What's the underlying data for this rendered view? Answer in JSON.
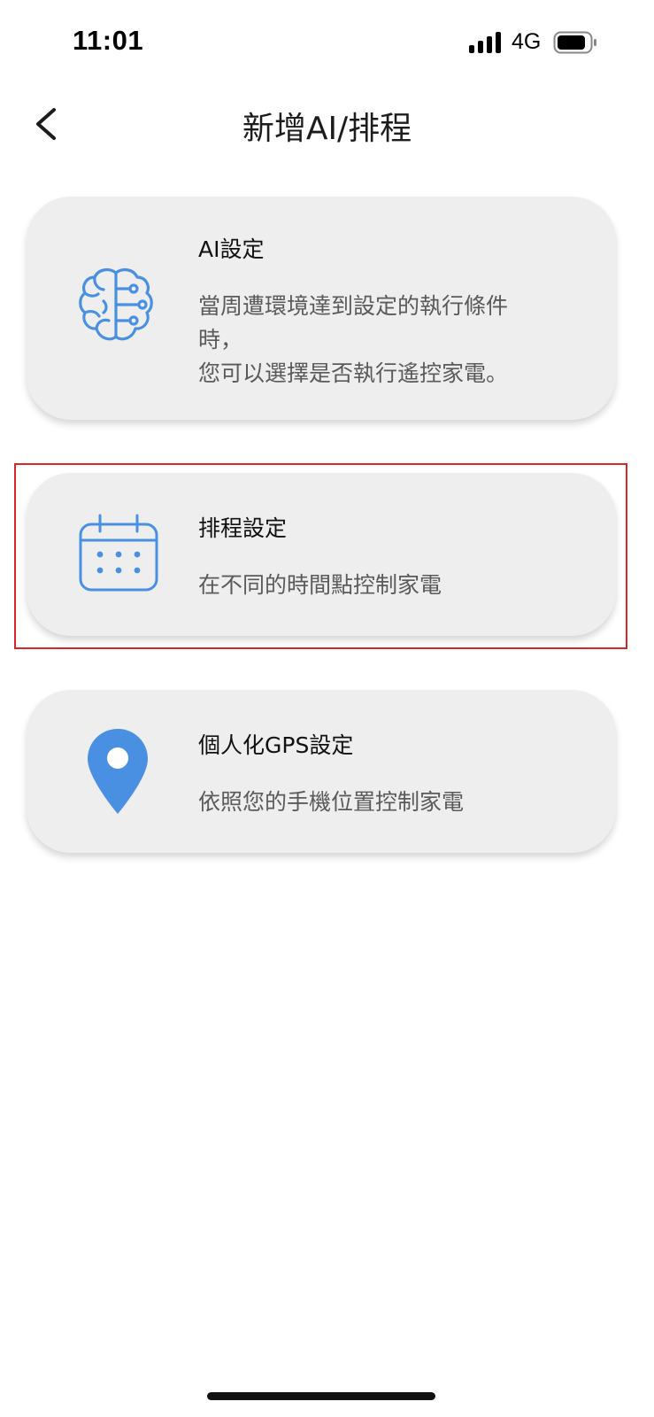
{
  "status_bar": {
    "time": "11:01",
    "network": "4G"
  },
  "header": {
    "title": "新增AI/排程",
    "back_icon": "chevron-left-icon"
  },
  "cards": [
    {
      "id": "ai",
      "icon": "brain-circuit-icon",
      "title": "AI設定",
      "description_lines": [
        "當周遭環境達到設定的執行條件",
        "時，",
        "您可以選擇是否執行遙控家電。"
      ]
    },
    {
      "id": "schedule",
      "icon": "calendar-icon",
      "title": "排程設定",
      "description_lines": [
        "在不同的時間點控制家電"
      ],
      "highlighted": true
    },
    {
      "id": "gps",
      "icon": "location-pin-icon",
      "title": "個人化GPS設定",
      "description_lines": [
        "依照您的手機位置控制家電"
      ]
    }
  ],
  "colors": {
    "accent": "#4a90e2",
    "card_bg": "#eeeeee",
    "highlight": "#d9252a"
  }
}
